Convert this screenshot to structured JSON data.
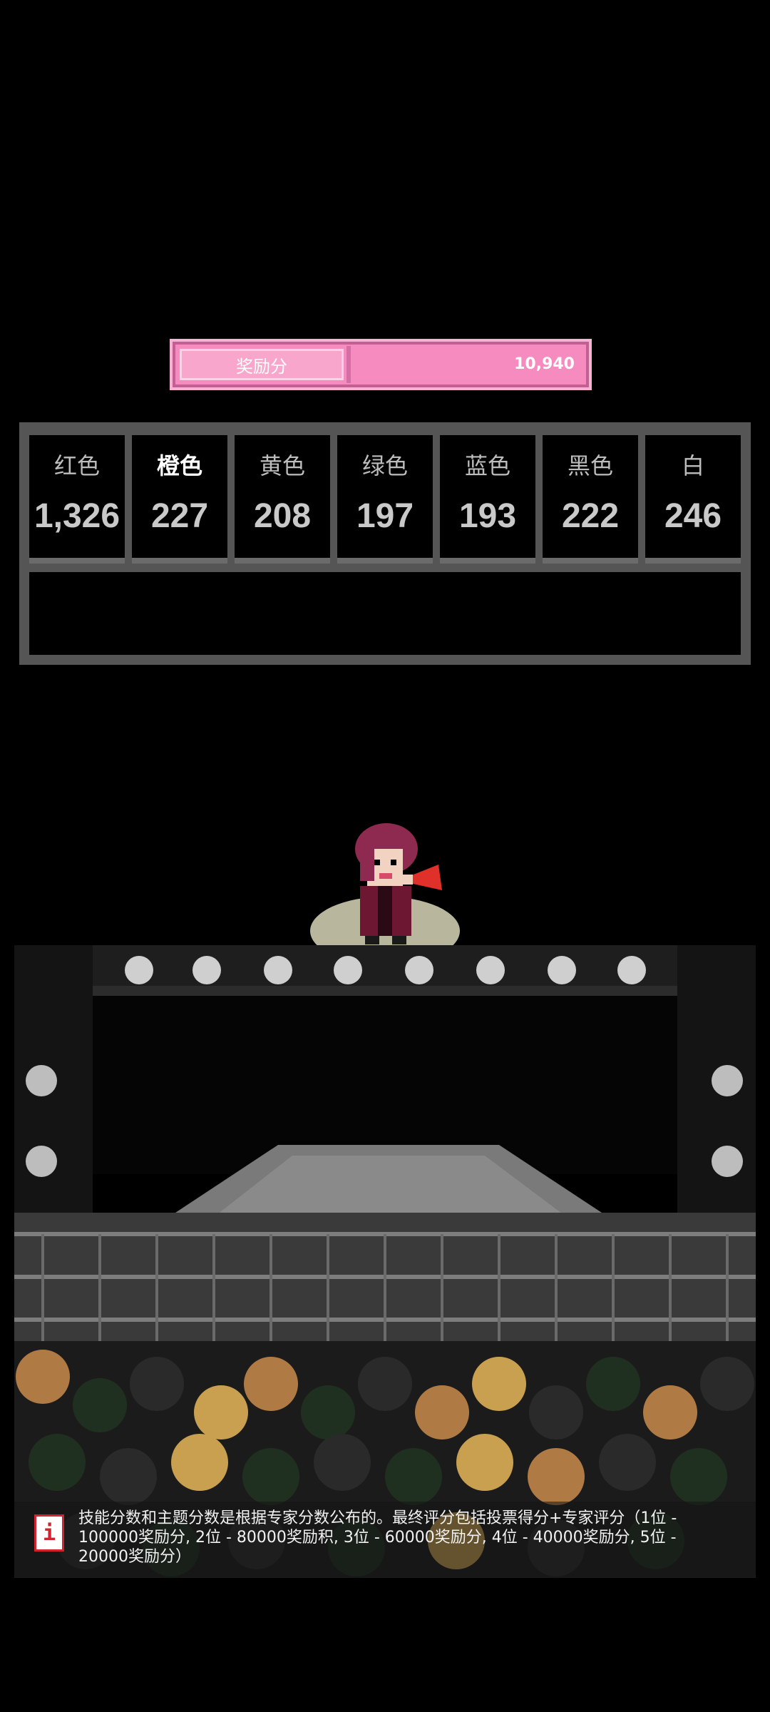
{
  "reward": {
    "label": "奖励分",
    "value": "10,940"
  },
  "scores": [
    {
      "name": "红色",
      "count": "1,326",
      "active": false
    },
    {
      "name": "橙色",
      "count": "227",
      "active": true
    },
    {
      "name": "黄色",
      "count": "208",
      "active": false
    },
    {
      "name": "绿色",
      "count": "197",
      "active": false
    },
    {
      "name": "蓝色",
      "count": "193",
      "active": false
    },
    {
      "name": "黑色",
      "count": "222",
      "active": false
    },
    {
      "name": "白",
      "count": "246",
      "active": false
    }
  ],
  "info": {
    "icon": "info-icon",
    "text": "技能分数和主题分数是根据专家分数公布的。最终评分包括投票得分+专家评分（1位 - 100000奖励分, 2位 -  80000奖励积, 3位 -  60000奖励分, 4位 -  40000奖励分, 5位 - 20000奖励分）"
  },
  "colors": {
    "pink": "#f58bbf",
    "panel": "#555555",
    "accent_red": "#d1242f"
  }
}
